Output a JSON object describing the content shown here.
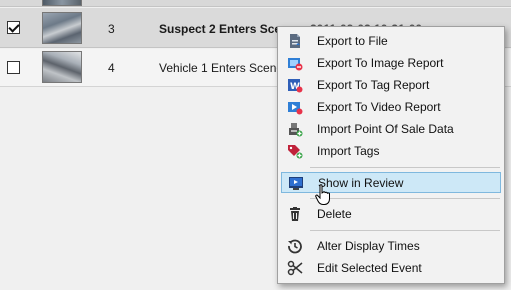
{
  "event_list": {
    "rows": [
      {
        "checked": true,
        "number": "3",
        "title": "Suspect 2 Enters Scene",
        "timestamp": "2011-09-02 10:31:00"
      },
      {
        "checked": false,
        "number": "4",
        "title": "Vehicle 1 Enters Scene"
      }
    ]
  },
  "context_menu": {
    "items": [
      {
        "label": "Export to File",
        "icon": "export-file-icon"
      },
      {
        "label": "Export To Image Report",
        "icon": "image-report-icon"
      },
      {
        "label": "Export To Tag Report",
        "icon": "tag-report-icon"
      },
      {
        "label": "Export To Video Report",
        "icon": "video-report-icon"
      },
      {
        "label": "Import Point Of Sale Data",
        "icon": "pos-data-icon"
      },
      {
        "label": "Import Tags",
        "icon": "import-tags-icon"
      },
      {
        "label": "Show in Review",
        "icon": "review-icon",
        "hovered": true
      },
      {
        "label": "Delete",
        "icon": "trash-icon"
      },
      {
        "label": "Alter Display Times",
        "icon": "history-icon"
      },
      {
        "label": "Edit Selected Event",
        "icon": "scissors-icon"
      }
    ]
  },
  "colors": {
    "hover_bg": "#cde8f7",
    "hover_border": "#7fb8de",
    "menu_bg": "#f2f2f2",
    "selected_row_bg": "#dadada"
  }
}
